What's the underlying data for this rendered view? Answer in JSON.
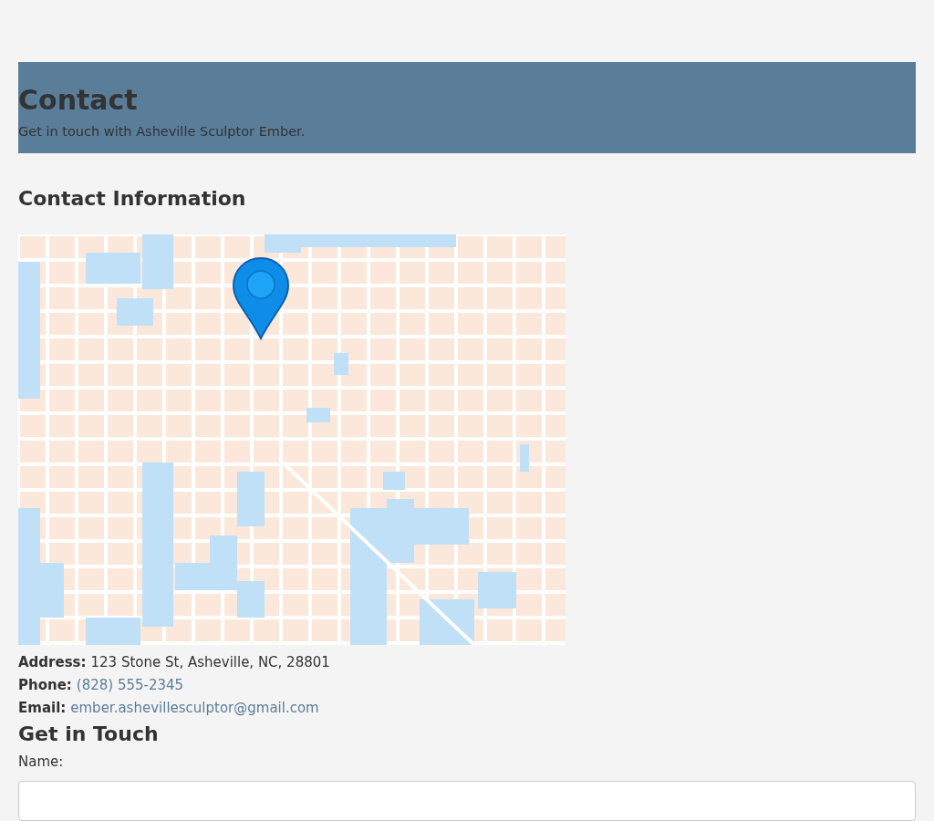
{
  "header": {
    "title": "Contact",
    "subtitle": "Get in touch with Asheville Sculptor Ember."
  },
  "contact_information": {
    "heading": "Contact Information",
    "details": [
      {
        "kind": "text",
        "label": "Address:",
        "value": "123 Stone St, Asheville, NC, 28801"
      },
      {
        "kind": "link",
        "label": "Phone:",
        "value": "(828) 555-2345"
      },
      {
        "kind": "link",
        "label": "Email:",
        "value": "ember.ashevillesculptor@gmail.com"
      }
    ]
  },
  "form": {
    "heading": "Get in Touch",
    "fields": [
      {
        "label": "Name:"
      }
    ]
  }
}
